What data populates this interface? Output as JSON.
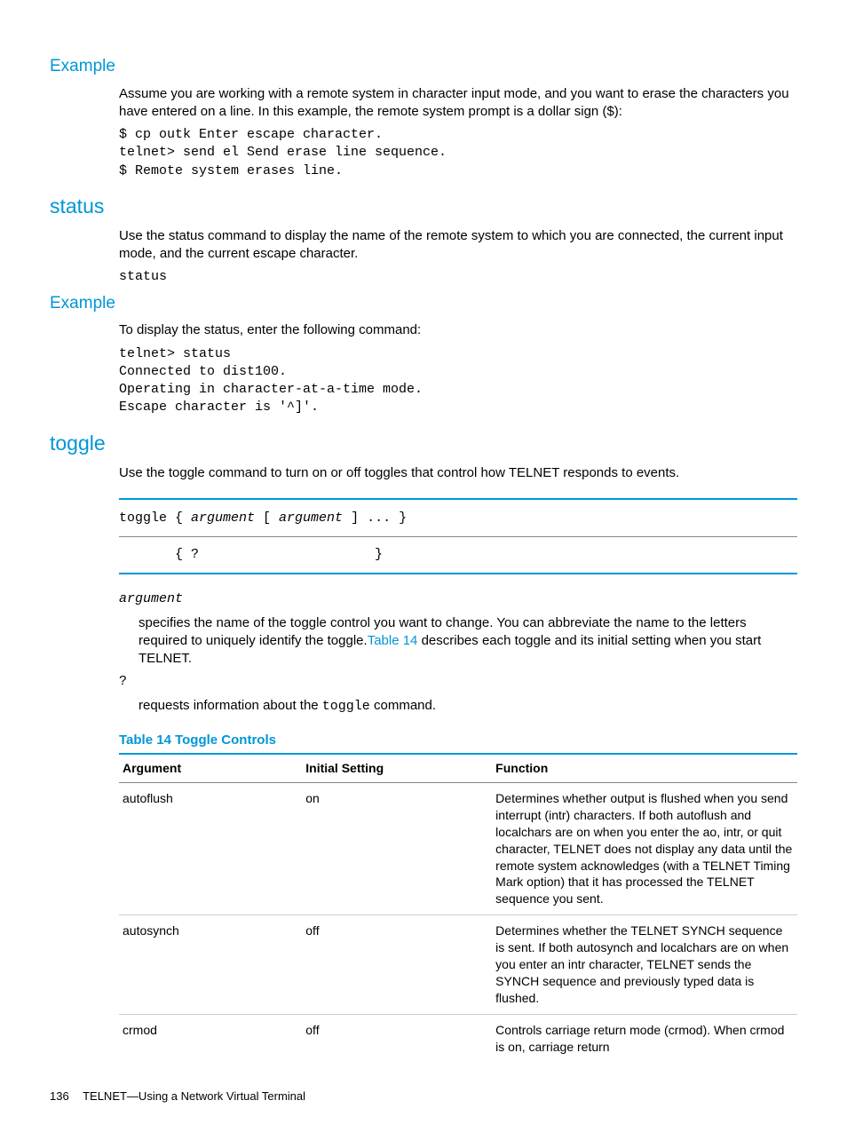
{
  "sections": {
    "example1_heading": "Example",
    "example1_para": "Assume you are working with a remote system in character input mode, and you want to erase the characters you have entered on a line. In this example, the remote system prompt is a dollar sign ($):",
    "example1_code": "$ cp outk Enter escape character.\ntelnet> send el Send erase line sequence.\n$ Remote system erases line.",
    "status_heading": "status",
    "status_para": "Use the status command to display the name of the remote system to which you are connected, the current input mode, and the current escape character.",
    "status_code": "status",
    "example2_heading": "Example",
    "example2_para": "To display the status, enter the following command:",
    "example2_code": "telnet> status\nConnected to dist100.\nOperating in character-at-a-time mode.\nEscape character is '^]'.",
    "toggle_heading": "toggle",
    "toggle_para": "Use the toggle command to turn on or off toggles that control how TELNET responds to events.",
    "toggle_syntax_line1_pre": "toggle { ",
    "toggle_syntax_line1_arg1": "argument",
    "toggle_syntax_line1_mid": " [ ",
    "toggle_syntax_line1_arg2": "argument",
    "toggle_syntax_line1_post": " ] ... }",
    "toggle_syntax_line2": "       { ?                      }",
    "argument_label": "argument",
    "argument_desc_pre": "specifies the name of the toggle control you want to change. You can abbreviate the name to the letters required to uniquely identify the toggle.",
    "argument_desc_link": "Table 14",
    "argument_desc_post": " describes each toggle and its initial setting when you start TELNET.",
    "question_label": "?",
    "question_desc_pre": "requests information about the ",
    "question_desc_code": "toggle",
    "question_desc_post": " command."
  },
  "table": {
    "title": "Table 14 Toggle Controls",
    "headers": [
      "Argument",
      "Initial Setting",
      "Function"
    ],
    "rows": [
      {
        "arg": "autoflush",
        "init": "on",
        "func": "Determines whether output is flushed when you send interrupt (intr) characters. If both autoflush and localchars are on when you enter the ao, intr, or quit character, TELNET does not display any data until the remote system acknowledges (with a TELNET Timing Mark option) that it has processed the TELNET sequence you sent."
      },
      {
        "arg": "autosynch",
        "init": "off",
        "func": "Determines whether the TELNET SYNCH sequence is sent. If both autosynch and localchars are on when you enter an intr character, TELNET sends the SYNCH sequence and previously typed data is flushed."
      },
      {
        "arg": "crmod",
        "init": "off",
        "func": "Controls carriage return mode (crmod). When crmod is on, carriage return"
      }
    ]
  },
  "footer": {
    "page_number": "136",
    "chapter_title": "TELNET—Using a Network Virtual Terminal"
  }
}
